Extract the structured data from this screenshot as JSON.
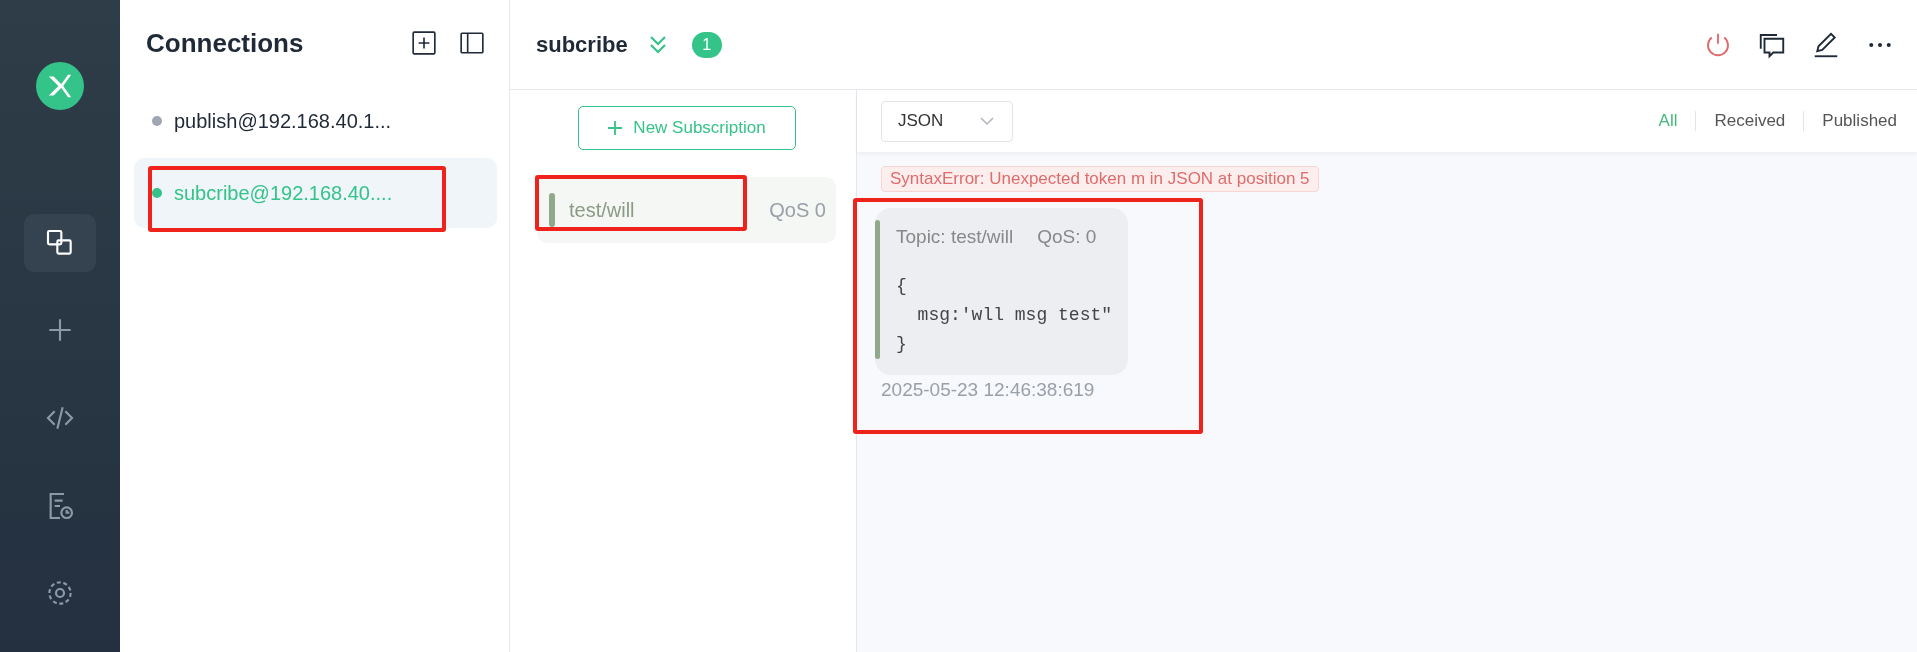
{
  "nav": {
    "items": [
      {
        "kind": "connections",
        "selected": true
      },
      {
        "kind": "new",
        "selected": false
      },
      {
        "kind": "script",
        "selected": false
      },
      {
        "kind": "log",
        "selected": false
      },
      {
        "kind": "settings",
        "selected": false
      }
    ]
  },
  "connections_panel": {
    "title": "Connections",
    "items": [
      {
        "name": "publish@192.168.40.1...",
        "connected": false,
        "selected": false,
        "highlighted": false
      },
      {
        "name": "subcribe@192.168.40....",
        "connected": true,
        "selected": true,
        "highlighted": true
      }
    ]
  },
  "header": {
    "title": "subcribe",
    "badge": "1"
  },
  "subscriptions": {
    "new_button": "New Subscription",
    "items": [
      {
        "topic": "test/will",
        "qos": "QoS 0",
        "color": "#8fa98a",
        "highlighted": true
      }
    ]
  },
  "messages": {
    "format": "JSON",
    "filters": [
      {
        "label": "All",
        "selected": true
      },
      {
        "label": "Received",
        "selected": false
      },
      {
        "label": "Published",
        "selected": false
      }
    ],
    "error": "SyntaxError: Unexpected token m in JSON at position 5",
    "items": [
      {
        "topic": "Topic: test/will",
        "qos": "QoS: 0",
        "payload": "{\n  msg:'wll msg test\"\n}",
        "time": "2025-05-23 12:46:38:619",
        "color": "#8fa98a",
        "highlighted": true
      }
    ]
  }
}
